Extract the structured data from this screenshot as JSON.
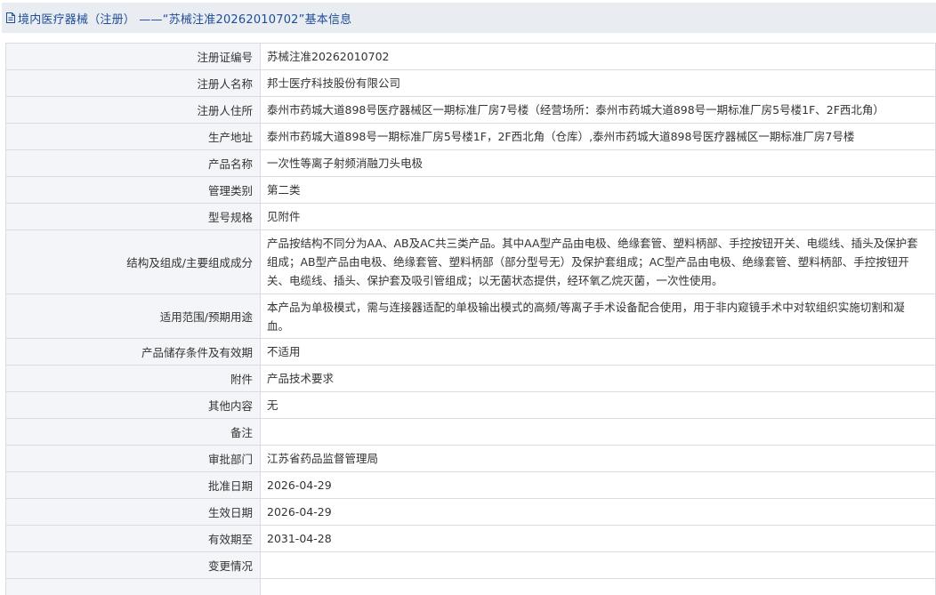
{
  "header": {
    "icon": "document-icon",
    "title": "境内医疗器械（注册） ——“苏械注准20262010702”基本信息"
  },
  "rows": [
    {
      "label": "注册证编号",
      "value": "苏械注准20262010702"
    },
    {
      "label": "注册人名称",
      "value": "邦士医疗科技股份有限公司"
    },
    {
      "label": "注册人住所",
      "value": "泰州市药城大道898号医疗器械区一期标准厂房7号楼（经营场所：泰州市药城大道898号一期标准厂房5号楼1F、2F西北角）"
    },
    {
      "label": "生产地址",
      "value": "泰州市药城大道898号一期标准厂房5号楼1F，2F西北角（仓库）,泰州市药城大道898号医疗器械区一期标准厂房7号楼"
    },
    {
      "label": "产品名称",
      "value": "一次性等离子射频消融刀头电极"
    },
    {
      "label": "管理类别",
      "value": "第二类"
    },
    {
      "label": "型号规格",
      "value": "见附件"
    },
    {
      "label": "结构及组成/主要组成成分",
      "value": "产品按结构不同分为AA、AB及AC共三类产品。其中AA型产品由电极、绝缘套管、塑料柄部、手控按钮开关、电缆线、插头及保护套组成；AB型产品由电极、绝缘套管、塑料柄部（部分型号无）及保护套组成；AC型产品由电极、绝缘套管、塑料柄部、手控按钮开关、电缆线、插头、保护套及吸引管组成；以无菌状态提供，经环氧乙烷灭菌，一次性使用。"
    },
    {
      "label": "适用范围/预期用途",
      "value": "本产品为单极模式，需与连接器适配的单极输出模式的高频/等离子手术设备配合使用，用于非内窥镜手术中对软组织实施切割和凝血。"
    },
    {
      "label": "产品储存条件及有效期",
      "value": "不适用"
    },
    {
      "label": "附件",
      "value": "产品技术要求"
    },
    {
      "label": "其他内容",
      "value": "无"
    },
    {
      "label": "备注",
      "value": ""
    },
    {
      "label": "审批部门",
      "value": "江苏省药品监督管理局"
    },
    {
      "label": "批准日期",
      "value": "2026-04-29"
    },
    {
      "label": "生效日期",
      "value": "2026-04-29"
    },
    {
      "label": "有效期至",
      "value": "2031-04-28"
    },
    {
      "label": "变更情况",
      "value": ""
    }
  ]
}
